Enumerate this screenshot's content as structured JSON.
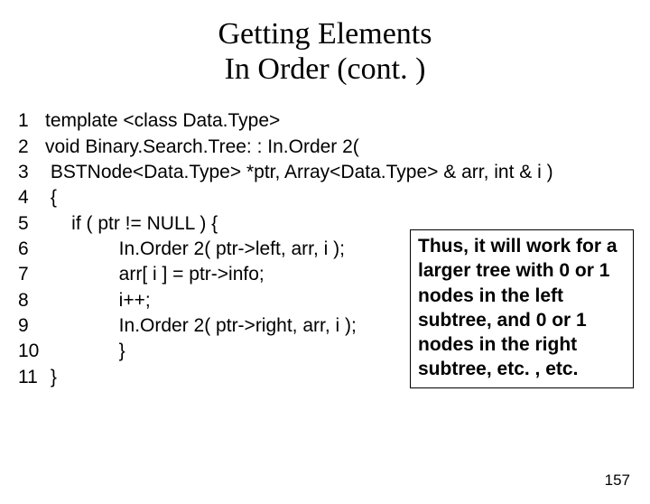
{
  "title_line1": "Getting Elements",
  "title_line2": "In Order (cont. )",
  "code": {
    "l1": "template <class Data.Type>",
    "l2": "void Binary.Search.Tree: : In.Order 2(",
    "l3": " BSTNode<Data.Type> *ptr, Array<Data.Type> & arr, int & i )",
    "l4": " {",
    "l5": "     if ( ptr != NULL ) {",
    "l6": "              In.Order 2( ptr->left, arr, i );",
    "l7": "              arr[ i ] = ptr->info;",
    "l8": "              i++;",
    "l9": "              In.Order 2( ptr->right, arr, i );",
    "l10": "              }",
    "l11": " }"
  },
  "annotation": "Thus, it will work for a larger tree with 0 or 1 nodes in the left subtree, and 0 or 1 nodes in the right subtree, etc. , etc.",
  "page_number": "157"
}
